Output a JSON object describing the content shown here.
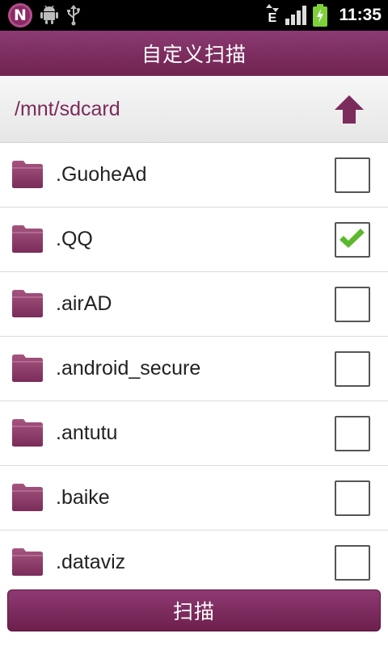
{
  "status_bar": {
    "app_icon": "n-logo-icon",
    "app_icon_letter": "N",
    "network_type": "E",
    "time": "11:35"
  },
  "header": {
    "title": "自定义扫描"
  },
  "path_bar": {
    "path": "/mnt/sdcard",
    "up_icon": "arrow-up-icon"
  },
  "folders": [
    {
      "name": ".GuoheAd",
      "checked": false
    },
    {
      "name": ".QQ",
      "checked": true
    },
    {
      "name": ".airAD",
      "checked": false
    },
    {
      "name": ".android_secure",
      "checked": false
    },
    {
      "name": ".antutu",
      "checked": false
    },
    {
      "name": ".baike",
      "checked": false
    },
    {
      "name": ".dataviz",
      "checked": false
    }
  ],
  "footer": {
    "scan_label": "扫描"
  },
  "colors": {
    "accent": "#7b2b5c",
    "check": "#5cb82e"
  }
}
